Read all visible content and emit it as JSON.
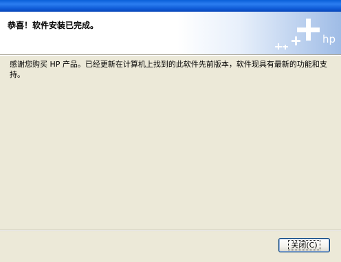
{
  "header": {
    "title": "恭喜！软件安装已完成。",
    "brand_mark": "hp"
  },
  "body": {
    "message": "感谢您购买 HP 产品。已经更新在计算机上找到的此软件先前版本，软件现具有最新的功能和支持。"
  },
  "footer": {
    "close_button_label": "关闭(C)"
  },
  "colors": {
    "titlebar": "#0a5fd8",
    "dialog_background": "#ece9d8",
    "header_background": "#ffffff",
    "brand_blue": "#9fbce6",
    "button_border": "#003c74"
  },
  "icons": {
    "brand": "hp-logo-with-plus-signs"
  }
}
